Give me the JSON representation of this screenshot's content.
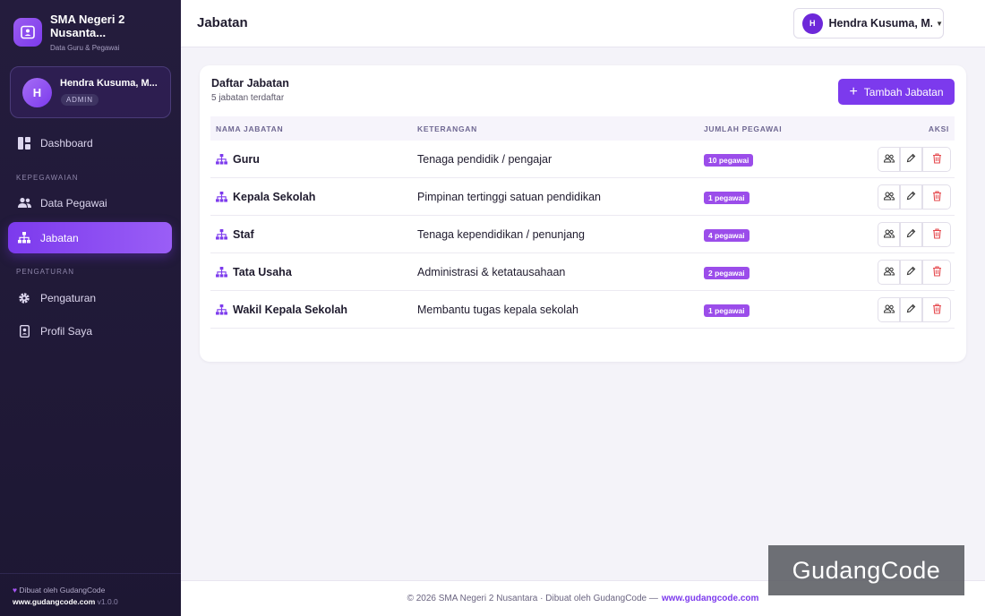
{
  "sidebar": {
    "brand_name": "SMA Negeri 2 Nusanta...",
    "brand_sub": "Data Guru & Pegawai",
    "user_name": "Hendra Kusuma, M...",
    "user_role": "ADMIN",
    "user_initial": "H",
    "nav": {
      "dashboard": "Dashboard",
      "section_kepegawaian": "KEPEGAWAIAN",
      "data_pegawai": "Data Pegawai",
      "jabatan": "Jabatan",
      "section_pengaturan": "PENGATURAN",
      "pengaturan": "Pengaturan",
      "profil": "Profil Saya"
    },
    "footer_credit": "Dibuat oleh GudangCode",
    "footer_url": "www.gudangcode.com",
    "footer_version": "v1.0.0"
  },
  "header": {
    "title": "Jabatan",
    "user_initial": "H",
    "user_name": "Hendra Kusuma, M.P..."
  },
  "card": {
    "title": "Daftar Jabatan",
    "subtitle": "5 jabatan terdaftar",
    "add_button": "Tambah Jabatan",
    "columns": {
      "name": "NAMA JABATAN",
      "desc": "KETERANGAN",
      "count": "JUMLAH PEGAWAI",
      "actions": "AKSI"
    },
    "rows": [
      {
        "name": "Guru",
        "desc": "Tenaga pendidik / pengajar",
        "count": "10 pegawai"
      },
      {
        "name": "Kepala Sekolah",
        "desc": "Pimpinan tertinggi satuan pendidikan",
        "count": "1 pegawai"
      },
      {
        "name": "Staf",
        "desc": "Tenaga kependidikan / penunjang",
        "count": "4 pegawai"
      },
      {
        "name": "Tata Usaha",
        "desc": "Administrasi & ketatausahaan",
        "count": "2 pegawai"
      },
      {
        "name": "Wakil Kepala Sekolah",
        "desc": "Membantu tugas kepala sekolah",
        "count": "1 pegawai"
      }
    ]
  },
  "footer": {
    "text": "© 2026 SMA Negeri 2 Nusantara · Dibuat oleh GudangCode —",
    "link": "www.gudangcode.com"
  },
  "watermark": "GudangCode",
  "colors": {
    "accent": "#7c3aed",
    "badge": "#9b4dea",
    "sidebar_bg": "#241c3d",
    "delete": "#e5484d"
  }
}
